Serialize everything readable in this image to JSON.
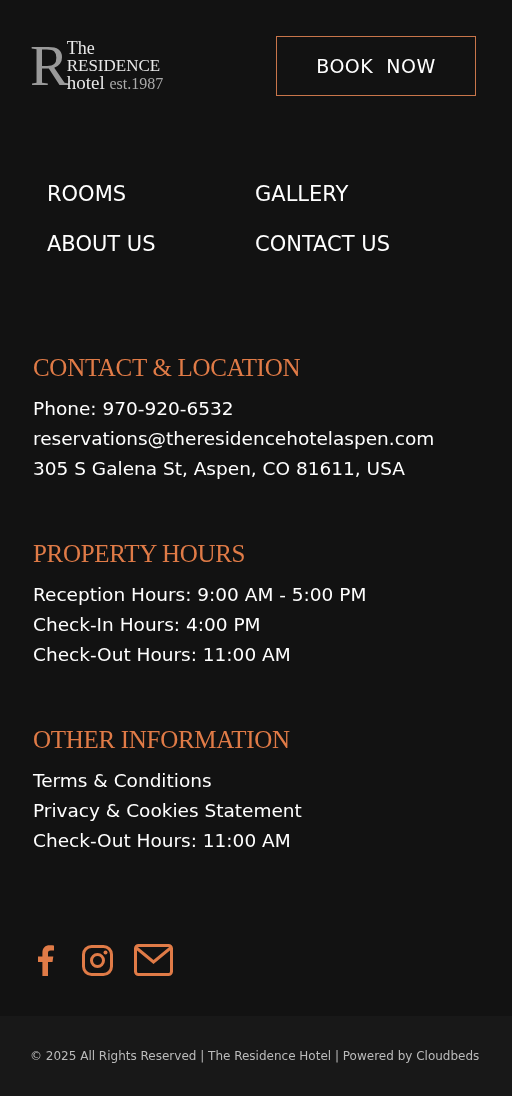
{
  "logo": {
    "monogram": "R",
    "line_1": "The",
    "line_2": "RESIDENCE",
    "line_3": "hotel",
    "established": "est.1987"
  },
  "book_button": "BOOK  NOW",
  "nav": [
    "ROOMS",
    "GALLERY",
    "ABOUT US",
    "CONTACT US"
  ],
  "sections": [
    {
      "title": "CONTACT & LOCATION",
      "lines": [
        "Phone: 970-920-6532",
        "reservations@theresidencehotelaspen.com",
        "305 S Galena St, Aspen, CO 81611, USA"
      ]
    },
    {
      "title": "PROPERTY HOURS",
      "lines": [
        "Reception Hours: 9:00 AM - 5:00 PM",
        "Check-In Hours: 4:00 PM",
        "Check-Out Hours: 11:00 AM"
      ]
    },
    {
      "title": "OTHER INFORMATION",
      "lines": [
        "Terms & Conditions",
        "Privacy & Cookies Statement",
        "Check-Out Hours: 11:00 AM"
      ]
    }
  ],
  "social": [
    {
      "kind": "facebook"
    },
    {
      "kind": "instagram"
    },
    {
      "kind": "mail"
    }
  ],
  "copyright": "© 2025 All Rights Reserved | The Residence Hotel | Powered by Cloudbeds"
}
